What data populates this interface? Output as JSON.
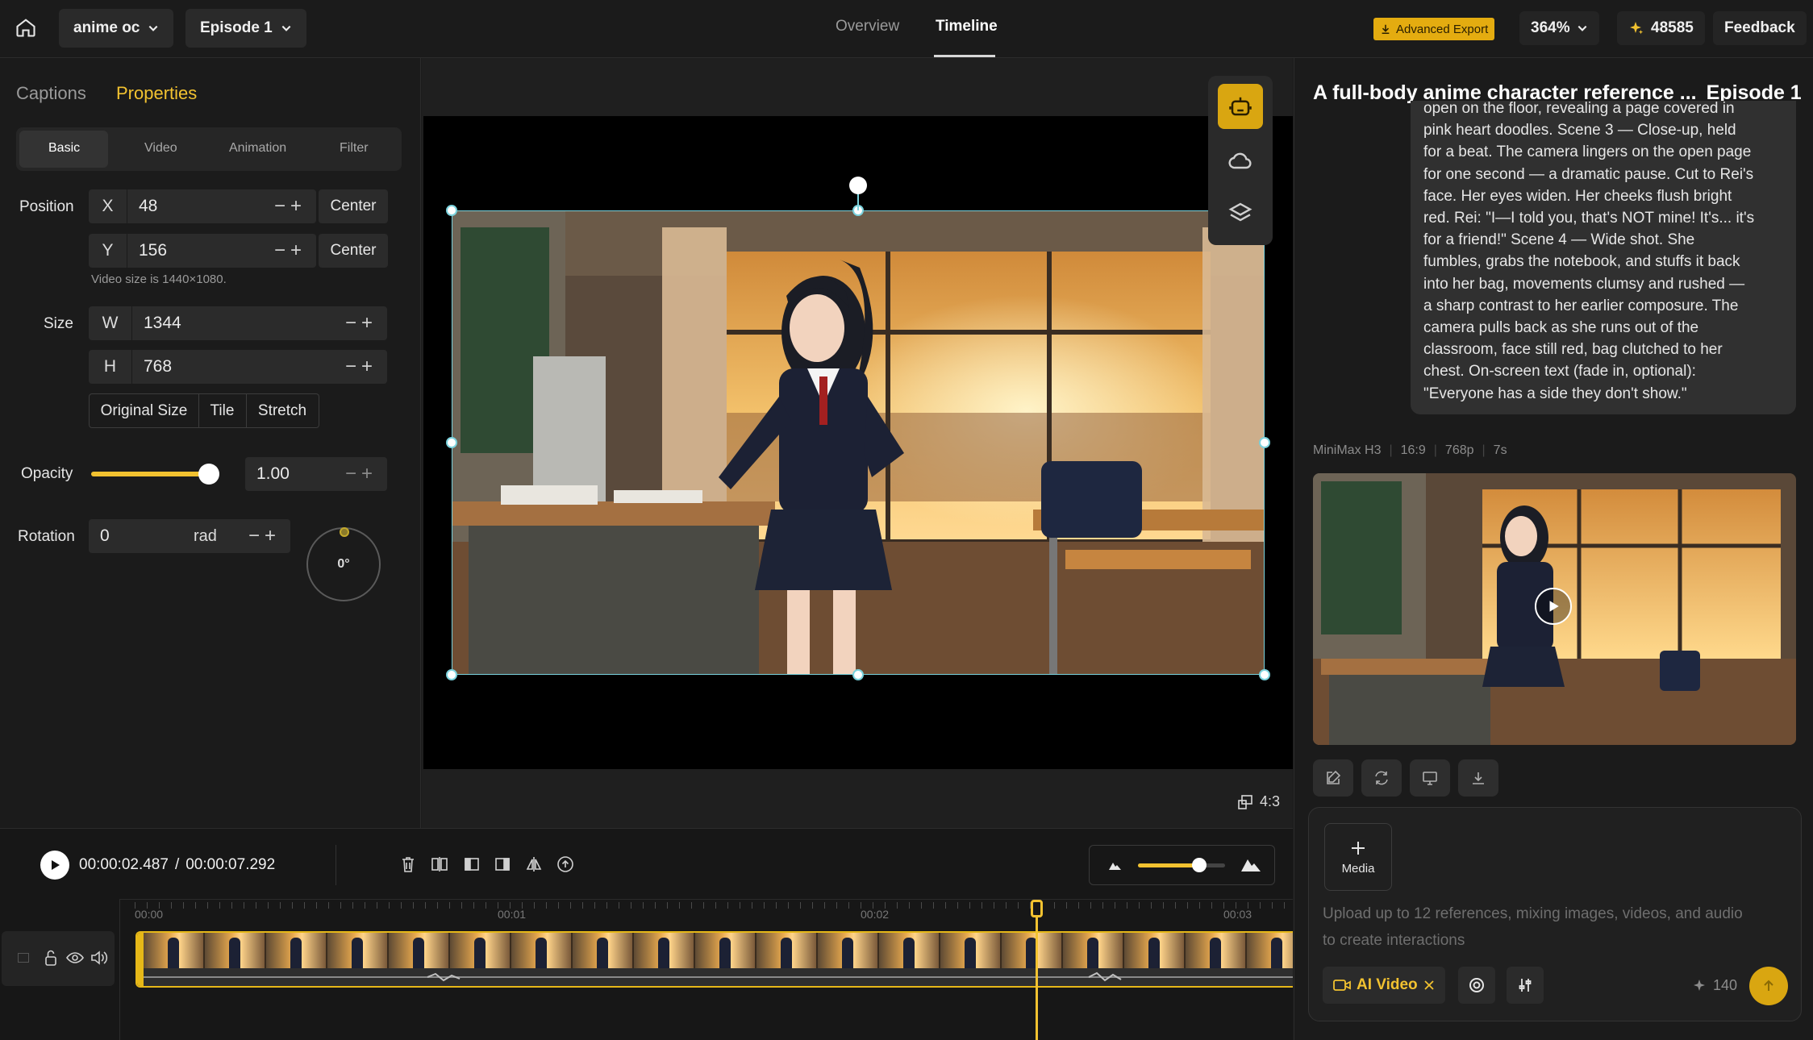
{
  "topbar": {
    "project": "anime oc",
    "episode": "Episode 1",
    "tabs": [
      "Overview",
      "Timeline"
    ],
    "advanced_export": "Advanced Export",
    "zoom": "364%",
    "credits": "48585",
    "feedback": "Feedback"
  },
  "left": {
    "tabs": [
      "Captions",
      "Properties"
    ],
    "subtabs": [
      "Basic",
      "Video",
      "Animation",
      "Filter"
    ],
    "position_label": "Position",
    "x_axis": "X",
    "x_value": "48",
    "y_axis": "Y",
    "y_value": "156",
    "center_label": "Center",
    "video_size_note": "Video size is 1440×1080.",
    "size_label": "Size",
    "w_axis": "W",
    "w_value": "1344",
    "h_axis": "H",
    "h_value": "768",
    "fit_buttons": [
      "Original Size",
      "Tile",
      "Stretch"
    ],
    "opacity_label": "Opacity",
    "opacity_value": "1.00",
    "opacity_level": 1.0,
    "rotation_label": "Rotation",
    "rotation_value": "0",
    "rotation_unit": "rad",
    "rotation_dial": "0°"
  },
  "center": {
    "aspect": "4:3"
  },
  "timeline": {
    "current_time": "00:00:02.487",
    "separator": "/",
    "total_time": "00:00:07.292",
    "ruler_labels": [
      "00:00",
      "00:01",
      "00:02",
      "00:03"
    ],
    "volume_level": 0.7
  },
  "right": {
    "title": "A full-body anime character reference ...",
    "episode": "Episode 1",
    "prompt_lines": [
      "open on the floor, revealing a page covered in",
      "pink heart doodles. Scene 3 — Close-up, held",
      "for a beat. The camera lingers on the open page",
      "for one second — a dramatic pause. Cut to Rei's",
      "face. Her eyes widen. Her cheeks flush bright",
      "red. Rei: \"I—I told you, that's NOT mine! It's... it's",
      "for a friend!\" Scene 4 — Wide shot. She",
      "fumbles, grabs the notebook, and stuffs it back",
      "into her bag, movements clumsy and rushed —",
      "a sharp contrast to her earlier composure. The",
      "camera pulls back as she runs out of the",
      "classroom, face still red, bag clutched to her",
      "chest. On-screen text (fade in, optional):",
      "\"Everyone has a side they don't show.\""
    ],
    "meta": [
      "MiniMax H3",
      "16:9",
      "768p",
      "7s"
    ],
    "media_label": "Media",
    "composer_placeholder": "Upload up to 12 references, mixing images, videos, and audio to create interactions",
    "mode": "AI Video",
    "cost": "140"
  },
  "colors": {
    "accent": "#f2c230",
    "handle": "#7ad2dd"
  }
}
